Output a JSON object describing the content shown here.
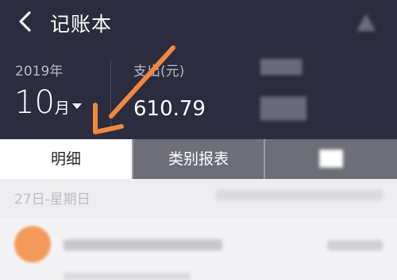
{
  "header": {
    "title": "记账本",
    "year": "2019年",
    "month_number": "10",
    "month_unit": "月",
    "expense_label": "支出(元)",
    "expense_value": "610.79"
  },
  "tabs": [
    {
      "label": "明细",
      "active": true
    },
    {
      "label": "类别报表",
      "active": false
    }
  ],
  "list": {
    "date_label": "27日-星期日"
  },
  "colors": {
    "header_bg": "#2b2c3d",
    "annotation_arrow": "#f0883e",
    "avatar": "#f39a5a"
  },
  "icons": [
    "back-arrow-icon",
    "dropdown-caret-icon"
  ]
}
